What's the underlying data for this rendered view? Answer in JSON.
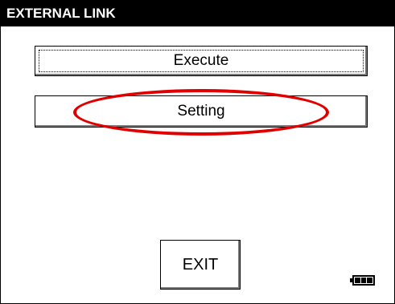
{
  "window": {
    "title": "EXTERNAL LINK"
  },
  "buttons": {
    "execute_label": "Execute",
    "setting_label": "Setting",
    "exit_label": "EXIT"
  },
  "status": {
    "battery_icon": "battery-full-icon"
  },
  "colors": {
    "titlebar_bg": "#000000",
    "titlebar_fg": "#ffffff",
    "highlight": "#e00000"
  }
}
